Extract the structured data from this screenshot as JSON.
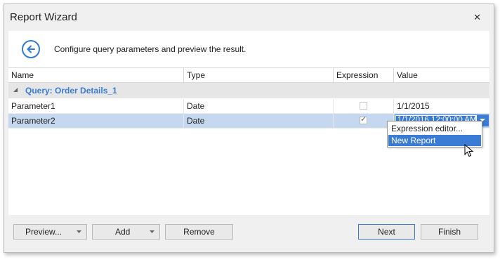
{
  "window": {
    "title": "Report Wizard",
    "close_glyph": "✕"
  },
  "header": {
    "text": "Configure query parameters and preview the result.",
    "back_icon": "arrow-left-circle-icon"
  },
  "grid": {
    "columns": [
      "Name",
      "Type",
      "Expression",
      "Value"
    ],
    "group": "Query: Order Details_1",
    "rows": [
      {
        "name": "Parameter1",
        "type": "Date",
        "expression": false,
        "value": "1/1/2015"
      },
      {
        "name": "Parameter2",
        "type": "Date",
        "expression": true,
        "value": "1/1/2016 12:00:00 AM"
      }
    ]
  },
  "dropdown": {
    "items": [
      "Expression editor...",
      "New Report Parameter..."
    ],
    "highlighted": 1
  },
  "buttons": {
    "preview": "Preview...",
    "add": "Add",
    "remove": "Remove",
    "next": "Next",
    "finish": "Finish"
  },
  "colors": {
    "accent": "#3a7bd5",
    "selected_row": "#c5d8f0",
    "group_row": "#e6e6e6"
  }
}
